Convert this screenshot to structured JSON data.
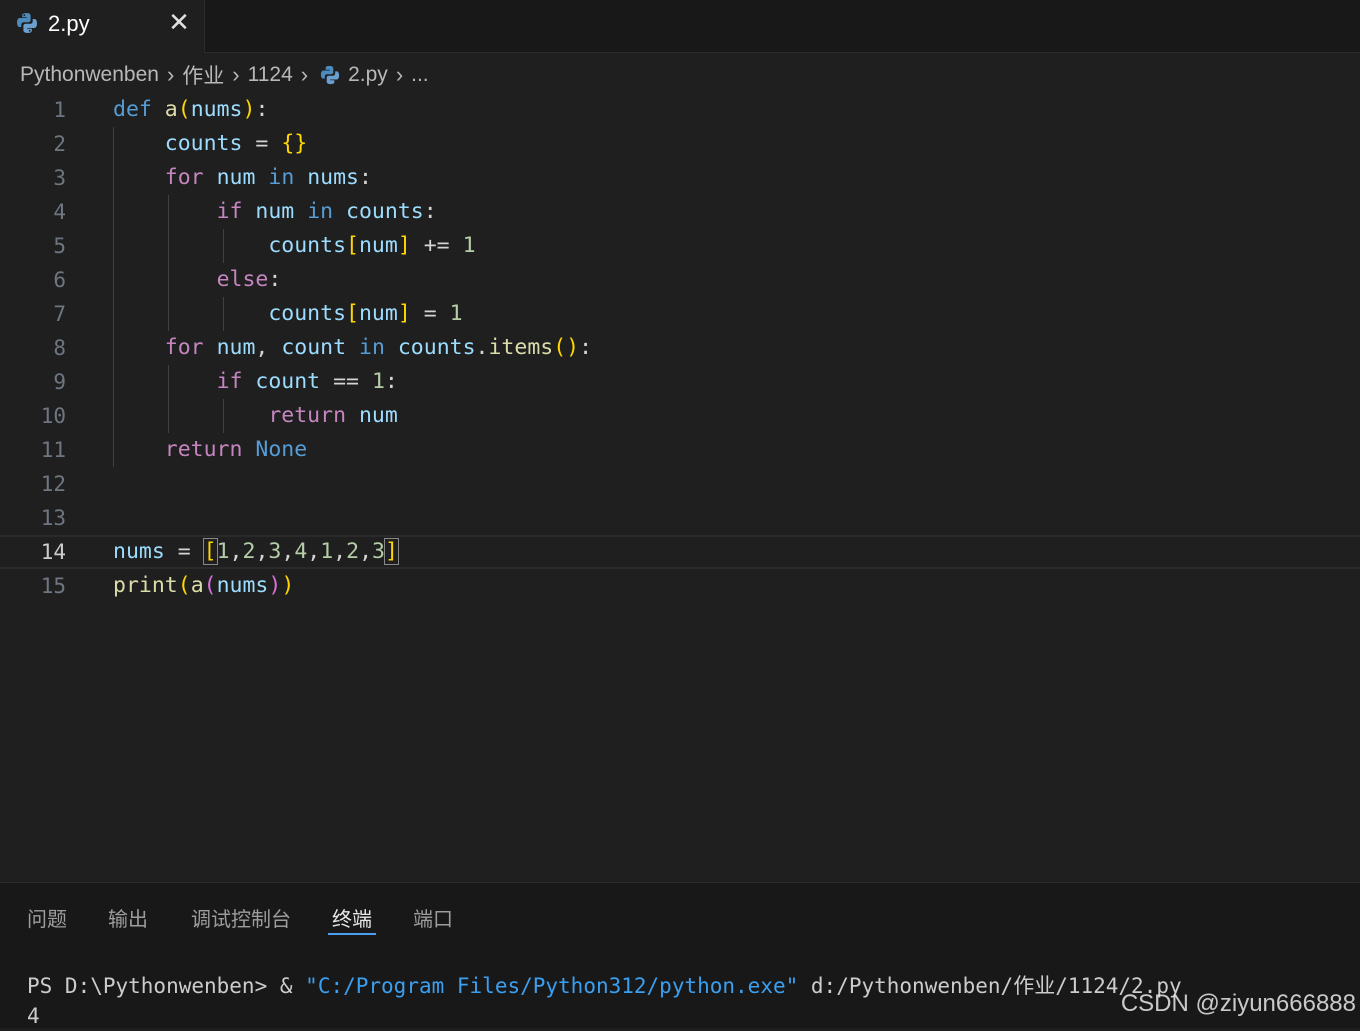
{
  "tab": {
    "label": "2.py",
    "close_glyph": "✕",
    "icon": "python-icon"
  },
  "breadcrumb": {
    "items": [
      "Pythonwenben",
      "作业",
      "1124",
      "2.py",
      "..."
    ],
    "separator": "›"
  },
  "editor": {
    "current_line": 14,
    "line_numbers": [
      "1",
      "2",
      "3",
      "4",
      "5",
      "6",
      "7",
      "8",
      "9",
      "10",
      "11",
      "12",
      "13",
      "14",
      "15"
    ],
    "lines": [
      "def a(nums):",
      "    counts = {}",
      "    for num in nums:",
      "        if num in counts:",
      "            counts[num] += 1",
      "        else:",
      "            counts[num] = 1",
      "    for num, count in counts.items():",
      "        if count == 1:",
      "            return num",
      "    return None",
      "",
      "",
      "nums = [1,2,3,4,1,2,3]",
      "print(a(nums))"
    ]
  },
  "panel": {
    "tabs": [
      "问题",
      "输出",
      "调试控制台",
      "终端",
      "端口"
    ],
    "active_tab": "终端",
    "terminal": {
      "prompt": "PS D:\\Pythonwenben> ",
      "operator": "& ",
      "exe": "\"C:/Program Files/Python312/python.exe\"",
      "script": " d:/Pythonwenben/作业/1124/2.py",
      "output": "4"
    }
  },
  "watermark": "CSDN @ziyun666888",
  "colors": {
    "background": "#1f1f1f",
    "keyword_blue": "#569cd6",
    "keyword_purple": "#c586c0",
    "function": "#dcdcaa",
    "variable": "#9cdcfe",
    "number": "#b5cea8",
    "bracket_gold": "#ffd700",
    "bracket_pink": "#da70d6",
    "active_tab_underline": "#4a9ff5"
  }
}
